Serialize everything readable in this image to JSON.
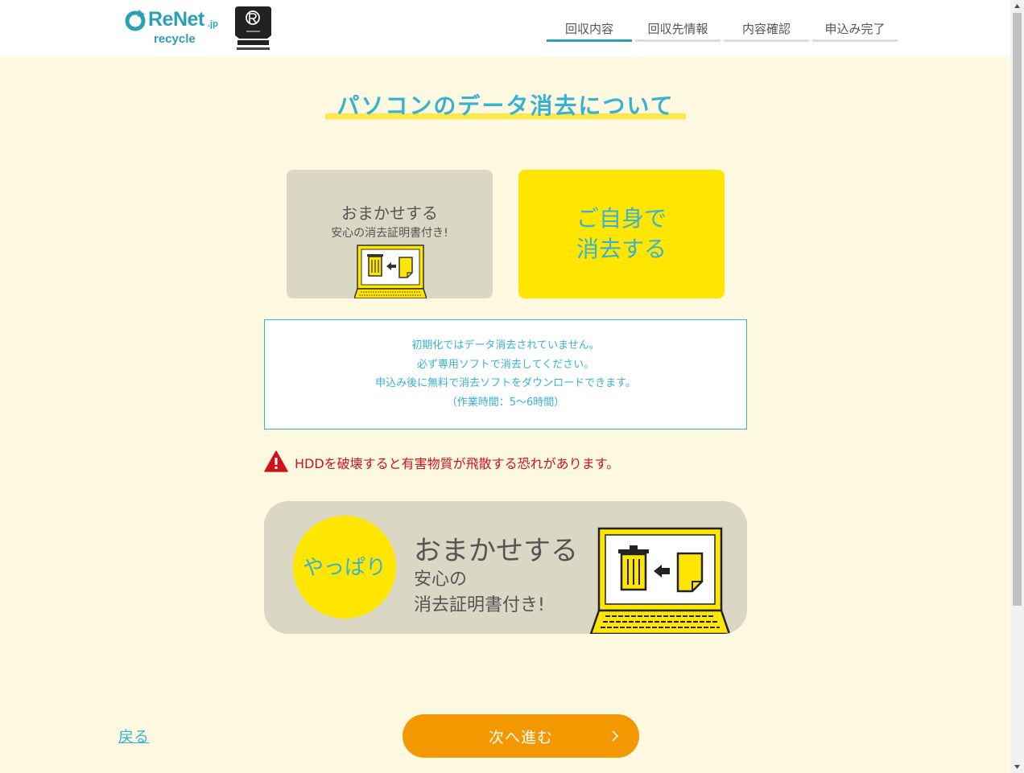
{
  "header": {
    "logo_text": "ReNet",
    "logo_suffix": ".jp",
    "logo_sub": "recycle",
    "badge_icon": "small-appliance-recycling-badge",
    "steps": [
      {
        "label": "回収内容"
      },
      {
        "label": "回収先情報"
      },
      {
        "label": "内容確認"
      },
      {
        "label": "申込み完了"
      }
    ]
  },
  "title": "パソコンのデータ消去について",
  "options": {
    "left": {
      "line1": "おまかせする",
      "line2": "安心の消去証明書付き!"
    },
    "right": {
      "line1": "ご自身で",
      "line2": "消去する"
    }
  },
  "info": {
    "lines": [
      "初期化ではデータ消去されていません。",
      "必ず専用ソフトで消去してください。",
      "申込み後に無料で消去ソフトをダウンロードできます。",
      "（作業時間：5〜6時間）"
    ]
  },
  "warning": "HDDを破壊すると有害物質が飛散する恐れがあります。",
  "alternative": {
    "badge": "やっぱり",
    "title": "おまかせする",
    "sub1": "安心の",
    "sub2": "消去証明書付き!"
  },
  "nav": {
    "back": "戻る",
    "next": "次へ進む"
  },
  "colors": {
    "accent": "#39b2d2",
    "background": "#fdf9e0",
    "yellow": "#ffe600",
    "gray_card": "#dad8c4",
    "next_button": "#f39800",
    "warning": "#d0121b"
  }
}
